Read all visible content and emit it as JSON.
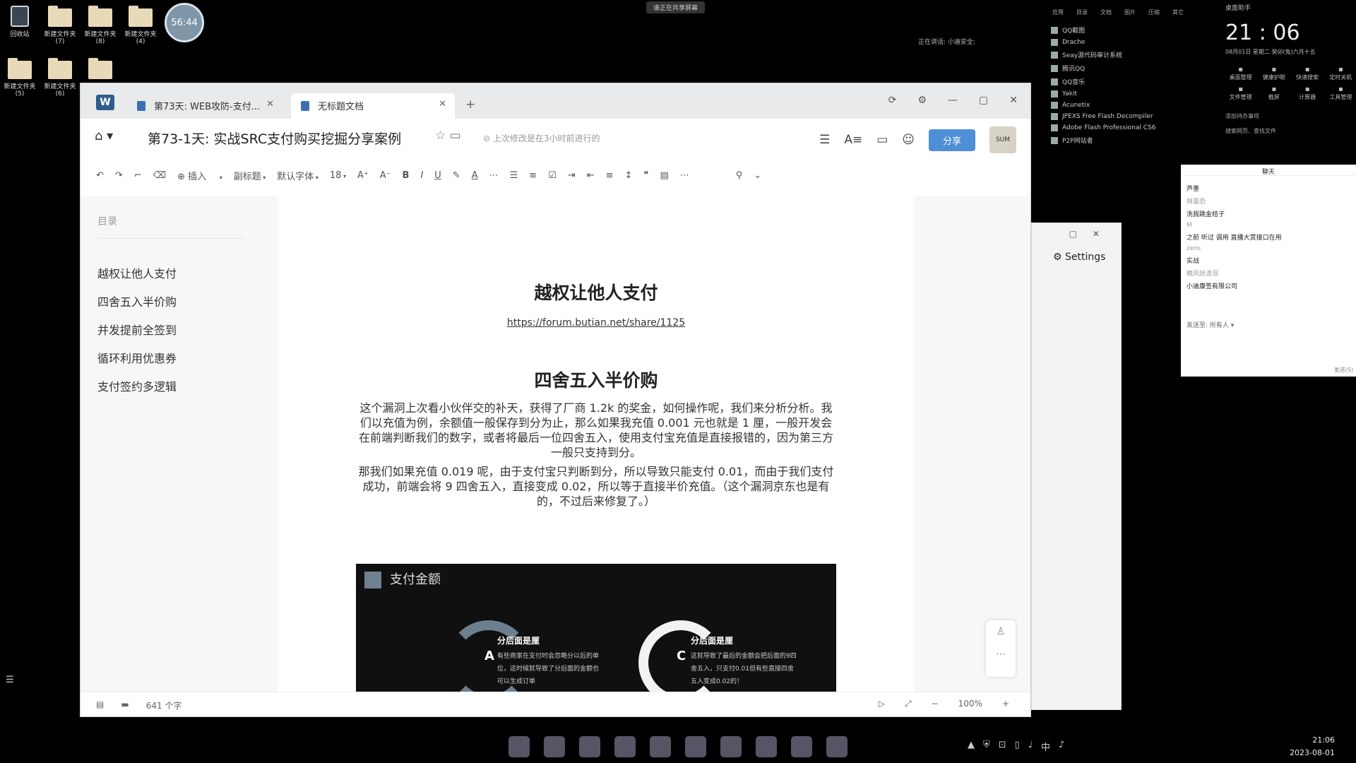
{
  "desktop": {
    "icons": [
      {
        "label": "回收站"
      },
      {
        "label": "新建文件夹 (7)"
      },
      {
        "label": "新建文件夹 (8)"
      },
      {
        "label": "新建文件夹 (4)"
      },
      {
        "label": "新建文件夹 (5)"
      },
      {
        "label": "新建文件夹 (6)"
      },
      {
        "label": ""
      }
    ],
    "timer": "56:44",
    "banner": "谁正在共享屏幕",
    "speaking": "正在讲话: 小迪安全;"
  },
  "app_list": {
    "tabs": [
      "应用",
      "目录",
      "文档",
      "图片",
      "压缩",
      "其它"
    ],
    "items": [
      "QQ截图",
      "Drache",
      "Seay源代码审计系统",
      "腾讯QQ",
      "QQ音乐",
      "Yakit",
      "Acunetix",
      "JPEXS Free Flash Decompiler",
      "Adobe Flash Professional CS6",
      "P2P网站者"
    ]
  },
  "clock_panel": {
    "label": "桌面助手",
    "time": "21 : 06",
    "date": "08月01日  星期二  癸卯(兔)六月十五",
    "tools": [
      "桌面整理",
      "健康护眼",
      "快速搜索",
      "定时关机",
      "文件管理",
      "截屏",
      "计算器",
      "工具管理"
    ],
    "extra1": "添加待办事项",
    "extra2": "搜索网页、查找文件"
  },
  "chat": {
    "title": "聊天",
    "messages": [
      {
        "nick": "",
        "text": "芦墨"
      },
      {
        "nick": "林蛋恐",
        "text": ""
      },
      {
        "nick": "",
        "text": "洗我跳金桔子"
      },
      {
        "nick": "M",
        "text": ""
      },
      {
        "nick": "",
        "text": "之前 听过 调用 直播大赏接口在用"
      },
      {
        "nick": "zero.",
        "text": ""
      },
      {
        "nick": "",
        "text": "实战"
      },
      {
        "nick": "晚风抚清泪",
        "text": ""
      },
      {
        "nick": "",
        "text": "小迪康签有限公司"
      }
    ],
    "send_to": "发送至:  所有人 ▾",
    "send_button": "发送(S)"
  },
  "settings_window": {
    "label": "Settings"
  },
  "wps": {
    "tabs": [
      {
        "label": "第73天: WEB攻防-支付..."
      },
      {
        "label": "无标题文档"
      }
    ],
    "doc_title": "第73-1天: 实战SRC支付购买挖掘分享案例",
    "save_status": "上次修改是在3小时前进行的",
    "share_label": "分享",
    "avatar_text": "SUM",
    "toolbar": {
      "insert": "插入",
      "style": "副标题",
      "font": "默认字体",
      "size": "18"
    },
    "outline": {
      "title": "目录",
      "items": [
        "越权让他人支付",
        "四舍五入半价购",
        "并发提前全签到",
        "循环利用优惠券",
        "支付签约多逻辑"
      ]
    },
    "page": {
      "heading1": "越权让他人支付",
      "link": "https://forum.butian.net/share/1125",
      "heading2": "四舍五入半价购",
      "para1": "这个漏洞上次看小伙伴交的补天，获得了厂商 1.2k 的奖金，如何操作呢，我们来分析分析。我们以充值为例，余额值一般保存到分为止，那么如果我充值 0.001 元也就是 1 厘，一般开发会在前端判断我们的数字，或者将最后一位四舍五入，使用支付宝充值是直接报错的，因为第三方一般只支持到分。",
      "para2": "那我们如果充值 0.019 呢，由于支付宝只判断到分，所以导致只能支付 0.01，而由于我们支付成功，前端会将 9 四舍五入，直接变成 0.02，所以等于直接半价充值。（这个漏洞京东也是有的，不过后来修复了。）",
      "image": {
        "caption": "支付金额",
        "card_a_letter": "A",
        "card_a_title": "分后面是厘",
        "card_a_text": "有些商家在支付时会忽略分以后的单位，这时候就导致了分后面的金额也可以生成订单",
        "card_c_letter": "C",
        "card_c_title": "分后面是厘",
        "card_c_text": "这就导致了最后的金额会把后面的9四舍五入，只支付0.01但有些直接四舍五入变成0.02的！"
      }
    },
    "status": {
      "word_count": "641 个字",
      "zoom": "100%"
    }
  },
  "taskbar": {
    "clock_time": "21:06",
    "clock_date": "2023-08-01",
    "ime": "中"
  }
}
